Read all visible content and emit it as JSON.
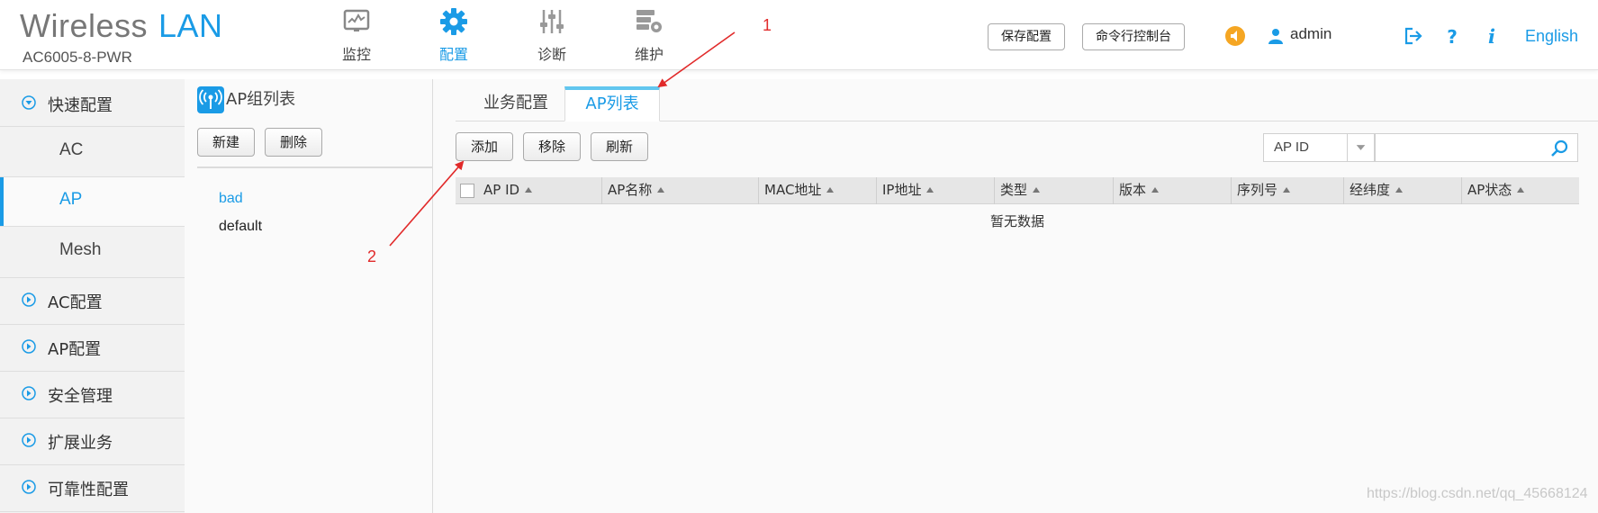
{
  "brand": {
    "title_part1": "Wireless",
    "title_part2": "LAN",
    "model": "AC6005-8-PWR"
  },
  "nav": {
    "items": [
      {
        "label": "监控",
        "icon": "monitor-icon",
        "active": false
      },
      {
        "label": "配置",
        "icon": "gear-icon",
        "active": true
      },
      {
        "label": "诊断",
        "icon": "sliders-icon",
        "active": false
      },
      {
        "label": "维护",
        "icon": "maintenance-icon",
        "active": false
      }
    ]
  },
  "header": {
    "save_config": "保存配置",
    "cli_console": "命令行控制台",
    "username": "admin",
    "language": "English",
    "icons": [
      "alarm-icon",
      "user-icon",
      "logout-icon",
      "help-icon",
      "info-icon"
    ]
  },
  "sidebar": {
    "items": [
      {
        "label": "快速配置",
        "icon": "chevron-down-circle-icon",
        "expanded": true
      },
      {
        "label": "AC",
        "sub": true
      },
      {
        "label": "AP",
        "sub": true,
        "active": true
      },
      {
        "label": "Mesh",
        "sub": true
      },
      {
        "label": "AC配置",
        "icon": "chevron-right-circle-icon"
      },
      {
        "label": "AP配置",
        "icon": "chevron-right-circle-icon"
      },
      {
        "label": "安全管理",
        "icon": "chevron-right-circle-icon"
      },
      {
        "label": "扩展业务",
        "icon": "chevron-right-circle-icon"
      },
      {
        "label": "可靠性配置",
        "icon": "chevron-right-circle-icon"
      }
    ]
  },
  "group_panel": {
    "title": "AP组列表",
    "new_label": "新建",
    "delete_label": "删除",
    "groups": [
      {
        "name": "bad",
        "selected": true
      },
      {
        "name": "default",
        "selected": false
      }
    ]
  },
  "main": {
    "tabs": [
      {
        "label": "业务配置",
        "active": false
      },
      {
        "label": "AP列表",
        "active": true
      }
    ],
    "toolbar": {
      "add_label": "添加",
      "remove_label": "移除",
      "refresh_label": "刷新"
    },
    "search": {
      "field_selected": "AP ID",
      "value": ""
    },
    "table": {
      "columns": [
        "AP ID",
        "AP名称",
        "MAC地址",
        "IP地址",
        "类型",
        "版本",
        "序列号",
        "经纬度",
        "AP状态"
      ],
      "empty_text": "暂无数据"
    }
  },
  "annotations": {
    "marker_1": "1",
    "marker_2": "2"
  },
  "watermark": "https://blog.csdn.net/qq_45668124",
  "colors": {
    "accent": "#1a9be6",
    "tab_accent": "#61c6ef",
    "annotation": "#e12a2a",
    "alarm": "#f5a623"
  }
}
